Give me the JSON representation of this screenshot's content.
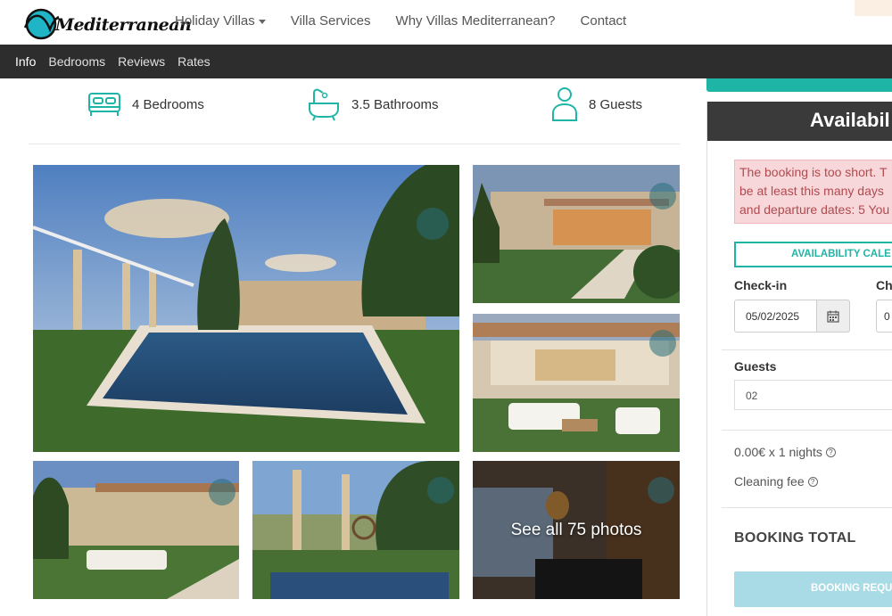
{
  "brand": {
    "logo_text": "Mediterranean"
  },
  "topnav": {
    "items": [
      {
        "label": "Holiday Villas",
        "has_dropdown": true
      },
      {
        "label": "Villa Services"
      },
      {
        "label": "Why Villas Mediterranean?"
      },
      {
        "label": "Contact"
      }
    ]
  },
  "subnav": {
    "tabs": [
      {
        "label": "Info",
        "active": true
      },
      {
        "label": "Bedrooms"
      },
      {
        "label": "Reviews"
      },
      {
        "label": "Rates"
      }
    ]
  },
  "stats": {
    "bedrooms": "4 Bedrooms",
    "bathrooms": "3.5 Bathrooms",
    "guests": "8 Guests"
  },
  "gallery": {
    "see_all_label": "See all 75 photos"
  },
  "booking": {
    "header": "Availabil",
    "alert_lines": [
      "The booking is too short. T",
      "be at least this many days",
      "and departure dates: 5 You"
    ],
    "calendar_button": "AVAILABILITY CALE",
    "checkin_label": "Check-in",
    "checkout_label": "Ch",
    "checkin_value": "05/02/2025",
    "checkout_value": "0",
    "guests_label": "Guests",
    "guests_value": "02",
    "nightly_line": "0.00€ x 1 nights",
    "cleaning_fee_label": "Cleaning fee",
    "total_label": "BOOKING TOTAL",
    "request_button": "BOOKING REQU"
  },
  "colors": {
    "accent_teal": "#1fb5a6",
    "subnav_bg": "#2d2d2d",
    "alert_bg": "#f8d7da",
    "alert_text": "#b04a4f",
    "button_disabled": "#a9dbe6"
  },
  "icons": {
    "bed": "bed-icon",
    "bath": "bathtub-icon",
    "guest": "person-icon",
    "calendar": "calendar-icon",
    "help": "question-circle-icon"
  }
}
